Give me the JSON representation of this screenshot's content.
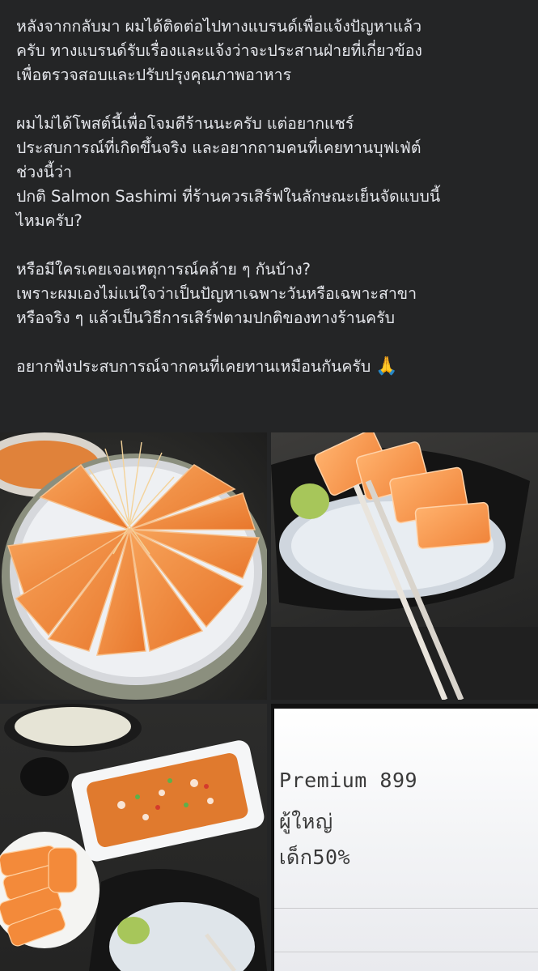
{
  "post": {
    "paragraphs": [
      "หลังจากกลับมา ผมได้ติดต่อไปทางแบรนด์เพื่อแจ้งปัญหาแล้ว\nครับ ทางแบรนด์รับเรื่องและแจ้งว่าจะประสานฝ่ายที่เกี่ยวข้อง\nเพื่อตรวจสอบและปรับปรุงคุณภาพอาหาร",
      "ผมไม่ได้โพสต์นี้เพื่อโจมตีร้านนะครับ แต่อยากแชร์\nประสบการณ์ที่เกิดขึ้นจริง และอยากถามคนที่เคยทานบุฟเฟ่ต์\nช่วงนี้ว่า\nปกติ Salmon Sashimi ที่ร้านควรเสิร์ฟในลักษณะเย็นจัดแบบนี้\nไหมครับ?",
      "หรือมีใครเคยเจอเหตุการณ์คล้าย ๆ กันบ้าง?\nเพราะผมเองไม่แน่ใจว่าเป็นปัญหาเฉพาะวันหรือเฉพาะสาขา\nหรือจริง ๆ แล้วเป็นวิธีการเสิร์ฟตามปกติของทางร้านครับ",
      "อยากฟังประสบการณ์จากคนที่เคยทานเหมือนกันครับ"
    ],
    "emoji": "🙏"
  },
  "photos": {
    "receipt": {
      "line1": "Premium 899",
      "line2": "ผู้ใหญ่",
      "line3": "เด็ก50%"
    }
  },
  "colors": {
    "background": "#242526",
    "text": "#e4e6eb",
    "salmon": "#f28a3c",
    "wasabi": "#a7c65a"
  }
}
